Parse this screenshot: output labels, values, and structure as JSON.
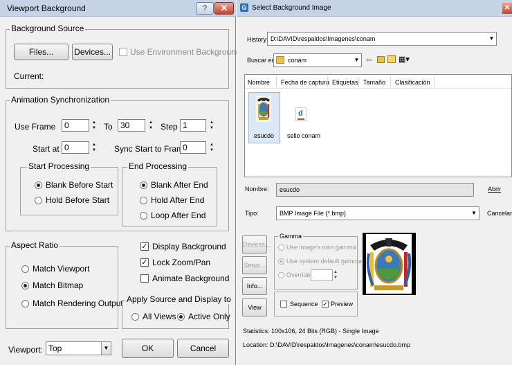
{
  "viewport_dialog": {
    "title": "Viewport Background",
    "help_label": "?",
    "close_label": "✕",
    "background_source": {
      "legend": "Background Source",
      "files_button": "Files...",
      "devices_button": "Devices...",
      "use_env_bg_label": "Use Environment Background",
      "current_label": "Current:"
    },
    "animation_sync": {
      "legend": "Animation Synchronization",
      "use_frame_label": "Use Frame",
      "use_frame_value": "0",
      "to_label": "To",
      "to_value": "30",
      "step_label": "Step",
      "step_value": "1",
      "start_at_label": "Start at",
      "start_at_value": "0",
      "sync_start_label": "Sync Start to Frame",
      "sync_start_value": "0",
      "start_processing": {
        "legend": "Start Processing",
        "options": [
          "Blank Before Start",
          "Hold Before Start"
        ],
        "selected": 0
      },
      "end_processing": {
        "legend": "End Processing",
        "options": [
          "Blank After End",
          "Hold After End",
          "Loop After End"
        ],
        "selected": 0
      }
    },
    "aspect_ratio": {
      "legend": "Aspect Ratio",
      "options": [
        "Match Viewport",
        "Match Bitmap",
        "Match Rendering Output"
      ],
      "selected": 1
    },
    "display_background_label": "Display Background",
    "lock_zoom_pan_label": "Lock Zoom/Pan",
    "animate_background_label": "Animate Background",
    "apply_source": {
      "legend": "Apply Source and Display to",
      "all_views_label": "All Views",
      "active_only_label": "Active Only"
    },
    "viewport_label": "Viewport:",
    "viewport_value": "Top",
    "ok_button": "OK",
    "cancel_button": "Cancel"
  },
  "select_dialog": {
    "title": "Select Background Image",
    "app_icon": "G",
    "close_label": "✕",
    "history_label": "History:",
    "history_value": "D:\\DAVID\\respaldos\\Imagenes\\conam",
    "lookin_label": "Buscar en:",
    "lookin_value": "conam",
    "columns": [
      "Nombre",
      "Fecha de captura",
      "Etiquetas",
      "Tamaño",
      "Clasificación"
    ],
    "files": [
      {
        "name": "esucdo"
      },
      {
        "name": "sello conam"
      }
    ],
    "filename_label": "Nombre:",
    "filename_value": "esucdo",
    "open_button": "Abrir",
    "type_label": "Tipo:",
    "type_value": "BMP Image File (*.bmp)",
    "cancel_button": "Cancelar",
    "devices_button": "Devices...",
    "setup_button": "Setup...",
    "info_button": "Info...",
    "view_button": "View",
    "gamma": {
      "legend": "Gamma",
      "own_gamma_label": "Use image's own gamma",
      "system_default_label": "Use system default gamma",
      "override_label": "Override"
    },
    "sequence_label": "Sequence",
    "preview_label": "Preview",
    "statistics": "Statistics: 100x106, 24 Bits (RGB) - Single Image",
    "location": "Location: D:\\DAVID\\respaldos\\Imagenes\\conam\\esucdo.bmp"
  }
}
